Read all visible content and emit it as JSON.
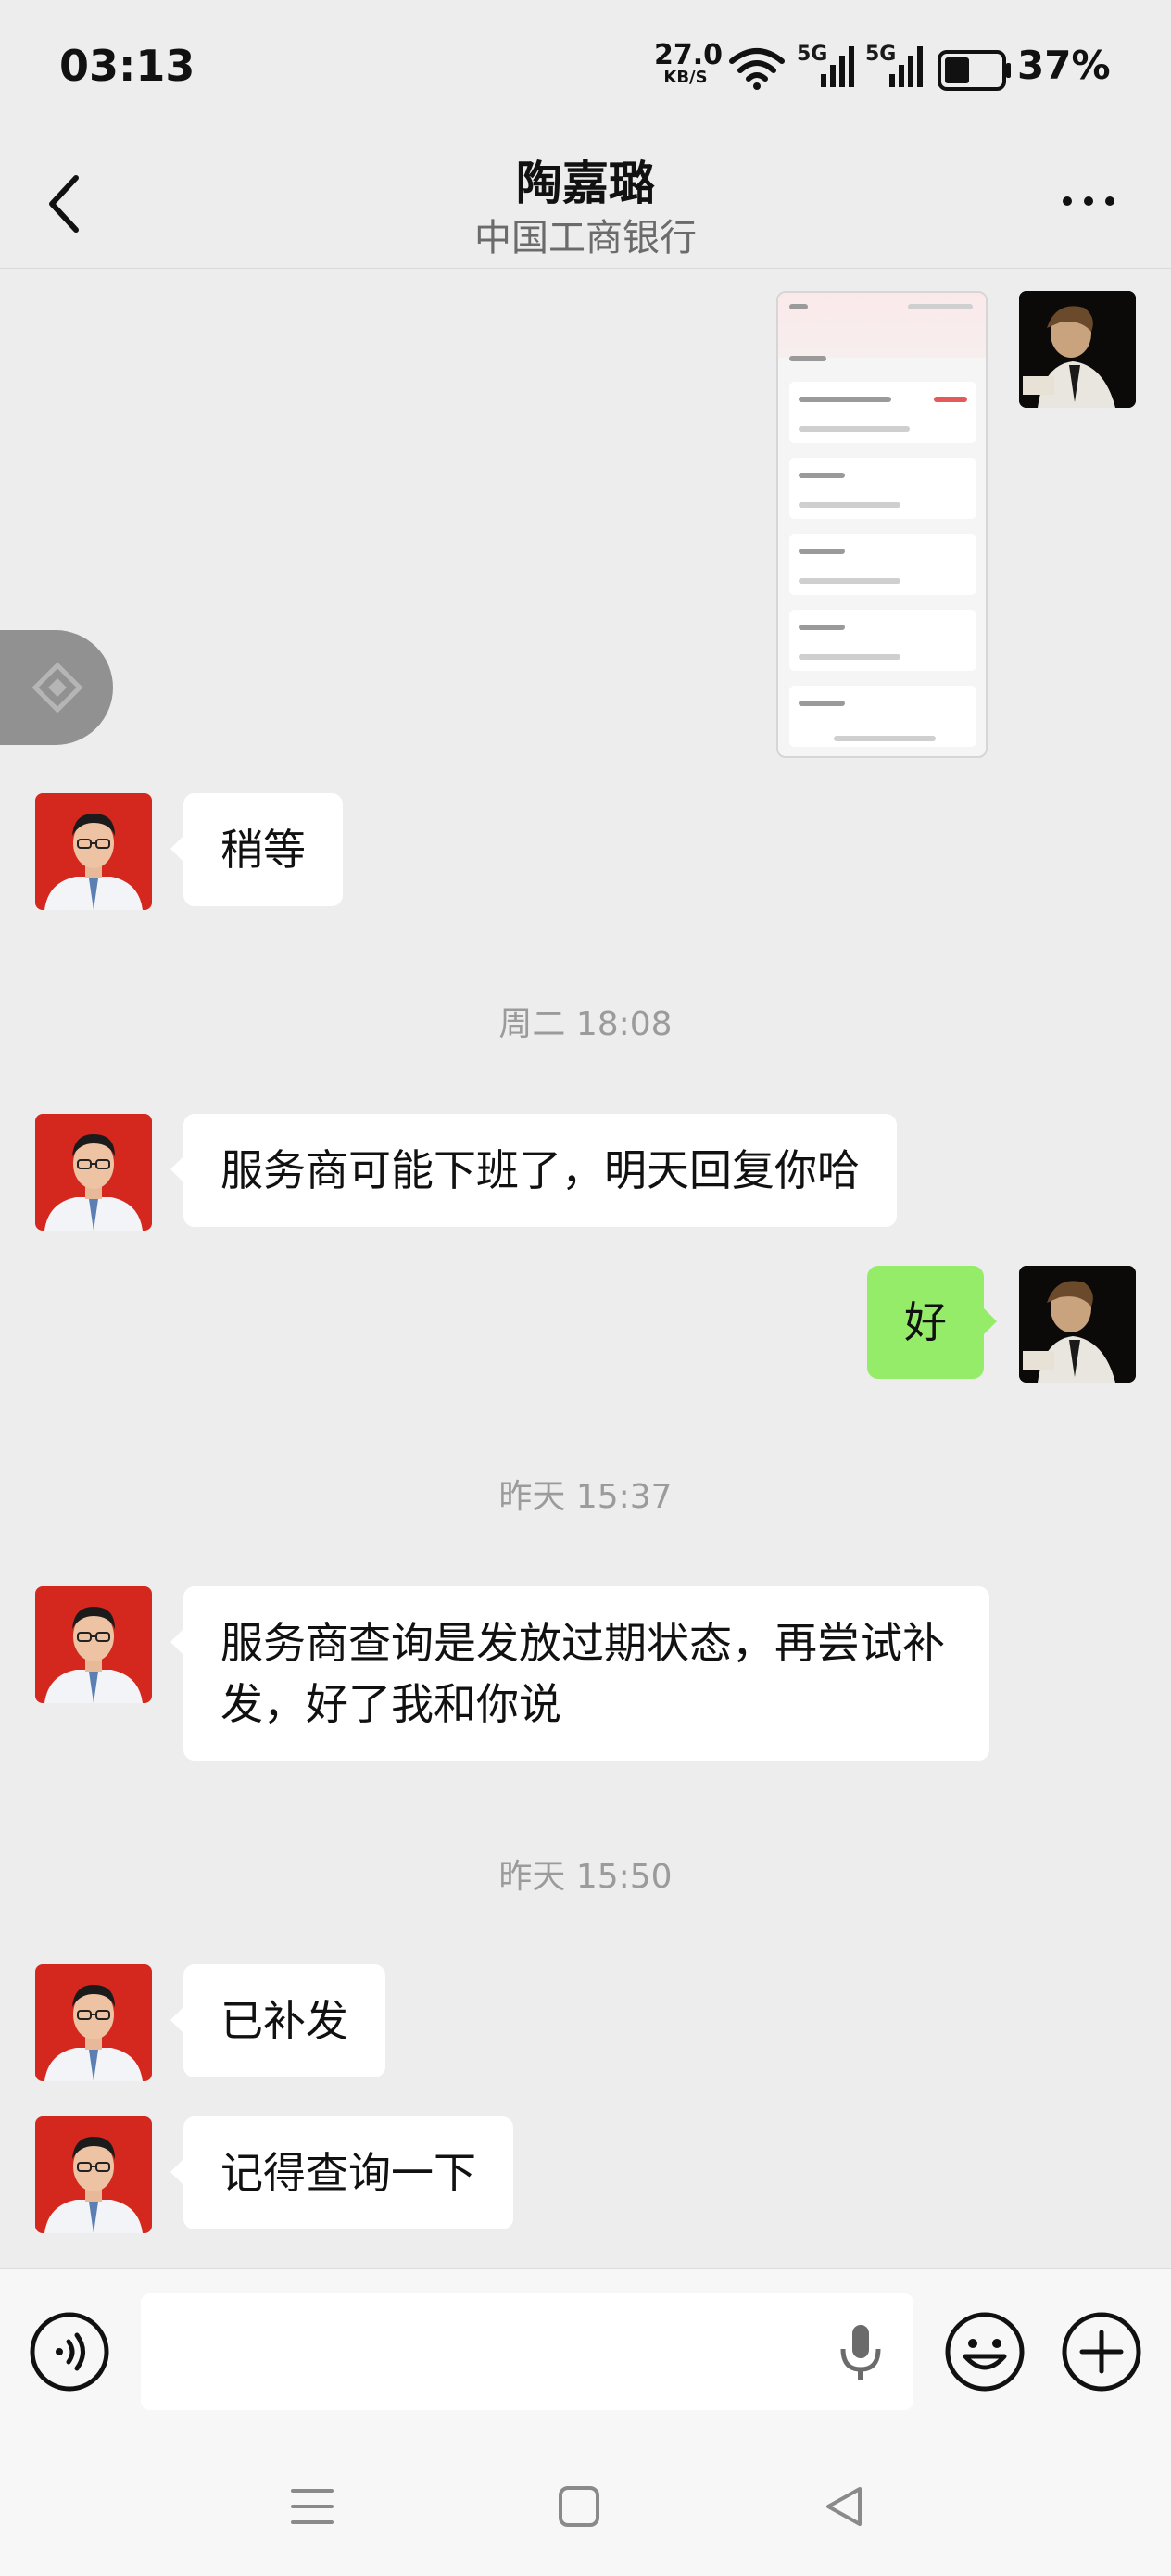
{
  "status_bar": {
    "time": "03:13",
    "net_speed_value": "27.0",
    "net_speed_unit": "KB/S",
    "signal_1_label": "5G",
    "signal_2_label": "5G",
    "battery_percent": "37%"
  },
  "header": {
    "title": "陶嘉璐",
    "subtitle": "中国工商银行"
  },
  "messages": [
    {
      "side": "right",
      "kind": "image",
      "image_desc": "screenshot"
    },
    {
      "side": "left",
      "text": "稍等"
    },
    {
      "timestamp": "周二 18:08"
    },
    {
      "side": "left",
      "text": "服务商可能下班了，明天回复你哈"
    },
    {
      "side": "right",
      "text": "好"
    },
    {
      "timestamp": "昨天 15:37"
    },
    {
      "side": "left",
      "text": "服务商查询是发放过期状态，再尝试补发，好了我和你说"
    },
    {
      "timestamp": "昨天 15:50"
    },
    {
      "side": "left",
      "text": "已补发"
    },
    {
      "side": "left",
      "text": "记得查询一下"
    }
  ],
  "input_bar": {
    "placeholder": ""
  },
  "colors": {
    "background": "#ededed",
    "incoming_bubble": "#ffffff",
    "outgoing_bubble": "#95ec69",
    "avatar_red": "#d4281e"
  },
  "icons": [
    "back-arrow-icon",
    "more-icon",
    "voice-icon",
    "mic-icon",
    "emoji-icon",
    "plus-icon",
    "menu-icon",
    "home-icon",
    "back-triangle-icon"
  ]
}
